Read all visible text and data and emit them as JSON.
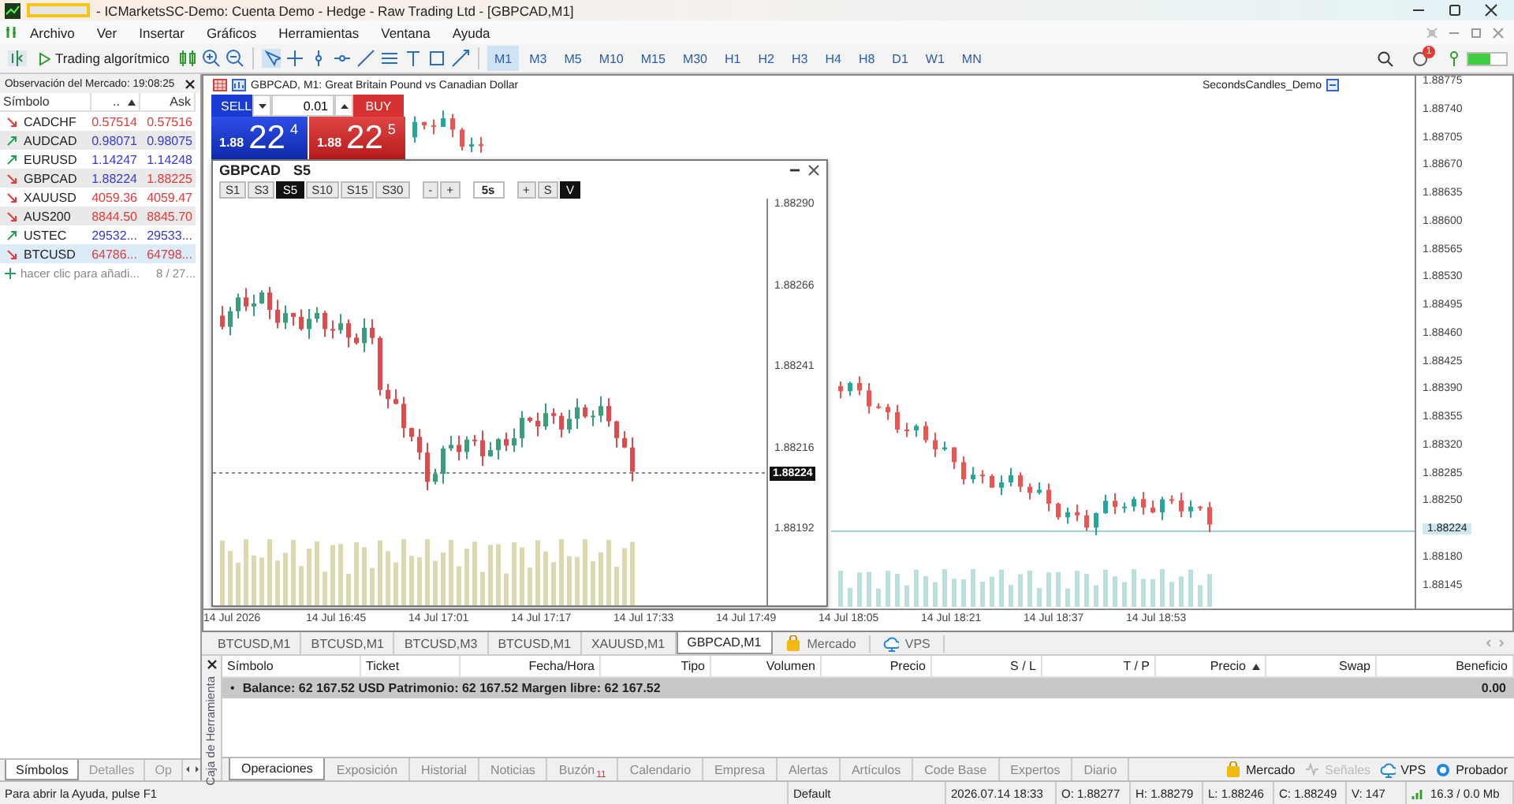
{
  "window": {
    "title": "- ICMarketsSC-Demo: Cuenta Demo - Hedge - Raw Trading Ltd - [GBPCAD,M1]"
  },
  "menu": [
    "Archivo",
    "Ver",
    "Insertar",
    "Gráficos",
    "Herramientas",
    "Ventana",
    "Ayuda"
  ],
  "toolbar": {
    "algo_button": "Trading algorítmico",
    "notification_badge": "1",
    "timeframes": [
      {
        "label": "M1",
        "selected": true
      },
      {
        "label": "M3",
        "selected": false
      },
      {
        "label": "M5",
        "selected": false
      },
      {
        "label": "M10",
        "selected": false
      },
      {
        "label": "M15",
        "selected": false
      },
      {
        "label": "M30",
        "selected": false
      },
      {
        "label": "H1",
        "selected": false
      },
      {
        "label": "H2",
        "selected": false
      },
      {
        "label": "H3",
        "selected": false
      },
      {
        "label": "H4",
        "selected": false
      },
      {
        "label": "H8",
        "selected": false
      },
      {
        "label": "D1",
        "selected": false
      },
      {
        "label": "W1",
        "selected": false
      },
      {
        "label": "MN",
        "selected": false
      }
    ]
  },
  "market_watch": {
    "title": "Observación del Mercado: 19:08:25",
    "columns": [
      {
        "label": "Símbolo",
        "sorted": false
      },
      {
        "label": "..",
        "sorted": true
      },
      {
        "label": "Ask",
        "sorted": false
      }
    ],
    "rows": [
      {
        "symbol": "CADCHF",
        "rising": false,
        "bid": "0.57514",
        "bid_up": false,
        "ask": "0.57516",
        "ask_up": false,
        "selected": false
      },
      {
        "symbol": "AUDCAD",
        "rising": true,
        "bid": "0.98071",
        "bid_up": true,
        "ask": "0.98075",
        "ask_up": true,
        "selected": false
      },
      {
        "symbol": "EURUSD",
        "rising": true,
        "bid": "1.14247",
        "bid_up": true,
        "ask": "1.14248",
        "ask_up": true,
        "selected": false
      },
      {
        "symbol": "GBPCAD",
        "rising": false,
        "bid": "1.88224",
        "bid_up": true,
        "ask": "1.88225",
        "ask_up": false,
        "selected": false
      },
      {
        "symbol": "XAUUSD",
        "rising": false,
        "bid": "4059.36",
        "bid_up": false,
        "ask": "4059.47",
        "ask_up": false,
        "selected": false
      },
      {
        "symbol": "AUS200",
        "rising": false,
        "bid": "8844.50",
        "bid_up": false,
        "ask": "8845.70",
        "ask_up": false,
        "selected": false
      },
      {
        "symbol": "USTEC",
        "rising": true,
        "bid": "29532...",
        "bid_up": true,
        "ask": "29533...",
        "ask_up": true,
        "selected": false
      },
      {
        "symbol": "BTCUSD",
        "rising": false,
        "bid": "64786...",
        "bid_up": false,
        "ask": "64798...",
        "ask_up": false,
        "selected": true
      }
    ],
    "add_hint": "hacer clic para añadi...",
    "count": "8 / 27..."
  },
  "left_tabs": [
    {
      "label": "Símbolos",
      "selected": true
    },
    {
      "label": "Detalles",
      "selected": false
    },
    {
      "label": "Op",
      "selected": false
    }
  ],
  "chart": {
    "title": "GBPCAD, M1:  Great Britain Pound vs Canadian Dollar",
    "expert": "SecondsCandles_Demo",
    "price_axis": [
      {
        "label": "1.88775",
        "current": false
      },
      {
        "label": "1.88740",
        "current": false
      },
      {
        "label": "1.88705",
        "current": false
      },
      {
        "label": "1.88670",
        "current": false
      },
      {
        "label": "1.88635",
        "current": false
      },
      {
        "label": "1.88600",
        "current": false
      },
      {
        "label": "1.88565",
        "current": false
      },
      {
        "label": "1.88530",
        "current": false
      },
      {
        "label": "1.88495",
        "current": false
      },
      {
        "label": "1.88460",
        "current": false
      },
      {
        "label": "1.88425",
        "current": false
      },
      {
        "label": "1.88390",
        "current": false
      },
      {
        "label": "1.88355",
        "current": false
      },
      {
        "label": "1.88320",
        "current": false
      },
      {
        "label": "1.88285",
        "current": false
      },
      {
        "label": "1.88250",
        "current": false
      },
      {
        "label": "1.88224",
        "current": true
      },
      {
        "label": "1.88180",
        "current": false
      },
      {
        "label": "1.88145",
        "current": false
      }
    ],
    "time_axis": [
      "14 Jul 2026",
      "14 Jul 16:45",
      "14 Jul 17:01",
      "14 Jul 17:17",
      "14 Jul 17:33",
      "14 Jul 17:49",
      "14 Jul 18:05",
      "14 Jul 18:21",
      "14 Jul 18:37",
      "14 Jul 18:53"
    ]
  },
  "trade_panel": {
    "sell": "SELL",
    "buy": "BUY",
    "volume": "0.01",
    "bid": {
      "head": "1.88",
      "big": "22",
      "tail": "4"
    },
    "ask": {
      "head": "1.88",
      "big": "22",
      "tail": "5"
    }
  },
  "seconds_window": {
    "symbol": "GBPCAD",
    "period": "S5",
    "periods": [
      {
        "label": "S1",
        "selected": false
      },
      {
        "label": "S3",
        "selected": false
      },
      {
        "label": "S5",
        "selected": true
      },
      {
        "label": "S10",
        "selected": false
      },
      {
        "label": "S15",
        "selected": false
      },
      {
        "label": "S30",
        "selected": false
      }
    ],
    "zoom": [
      "-",
      "+"
    ],
    "interval": "5s",
    "toggles": [
      {
        "label": "+",
        "on": false
      },
      {
        "label": "S",
        "on": false
      },
      {
        "label": "V",
        "on": true
      }
    ],
    "price_axis": [
      "1.88290",
      "1.88266",
      "1.88241",
      "1.88216",
      "1.88192"
    ],
    "current_price": "1.88224"
  },
  "chart_tabs": [
    {
      "label": "BTCUSD,M1",
      "selected": false
    },
    {
      "label": "BTCUSD,M1",
      "selected": false
    },
    {
      "label": "BTCUSD,M3",
      "selected": false
    },
    {
      "label": "BTCUSD,M1",
      "selected": false
    },
    {
      "label": "XAUUSD,M1",
      "selected": false
    },
    {
      "label": "GBPCAD,M1",
      "selected": true
    }
  ],
  "chart_links": [
    {
      "kind": "market",
      "label": "Mercado"
    },
    {
      "kind": "vps",
      "label": "VPS"
    }
  ],
  "toolbox": {
    "side_label": "Caja de Herramienta",
    "columns": [
      {
        "label": "Símbolo",
        "sorted": false
      },
      {
        "label": "Ticket",
        "sorted": false
      },
      {
        "label": "Fecha/Hora",
        "sorted": false
      },
      {
        "label": "Tipo",
        "sorted": false
      },
      {
        "label": "Volumen",
        "sorted": false
      },
      {
        "label": "Precio",
        "sorted": false
      },
      {
        "label": "S / L",
        "sorted": false
      },
      {
        "label": "T / P",
        "sorted": false
      },
      {
        "label": "Precio",
        "sorted": true
      },
      {
        "label": "Swap",
        "sorted": false
      },
      {
        "label": "Beneficio",
        "sorted": false
      }
    ],
    "bullet": "•",
    "summary": "Balance: 62 167.52 USD  Patrimonio: 62 167.52  Margen libre: 62 167.52",
    "profit": "0.00",
    "tabs": [
      {
        "label": "Operaciones",
        "selected": true
      },
      {
        "label": "Exposición",
        "selected": false
      },
      {
        "label": "Historial",
        "selected": false
      },
      {
        "label": "Noticias",
        "selected": false
      },
      {
        "label": "Buzón",
        "selected": false,
        "badge": "11"
      },
      {
        "label": "Calendario",
        "selected": false
      },
      {
        "label": "Empresa",
        "selected": false
      },
      {
        "label": "Alertas",
        "selected": false
      },
      {
        "label": "Artículos",
        "selected": false
      },
      {
        "label": "Code Base",
        "selected": false
      },
      {
        "label": "Expertos",
        "selected": false
      },
      {
        "label": "Diario",
        "selected": false
      }
    ],
    "links": [
      {
        "kind": "market",
        "label": "Mercado",
        "disabled": false
      },
      {
        "kind": "signals",
        "label": "Señales",
        "disabled": true
      },
      {
        "kind": "vps",
        "label": "VPS",
        "disabled": false
      },
      {
        "kind": "tester",
        "label": "Probador",
        "disabled": false
      }
    ]
  },
  "status_bar": {
    "help": "Para abrir la Ayuda, pulse F1",
    "profile": "Default",
    "time": "2026.07.14 18:33",
    "open": "O: 1.88277",
    "high": "H: 1.88279",
    "low": "L: 1.88246",
    "close": "C: 1.88249",
    "volume": "V: 147",
    "traffic": "16.3 / 0.0 Mb"
  }
}
